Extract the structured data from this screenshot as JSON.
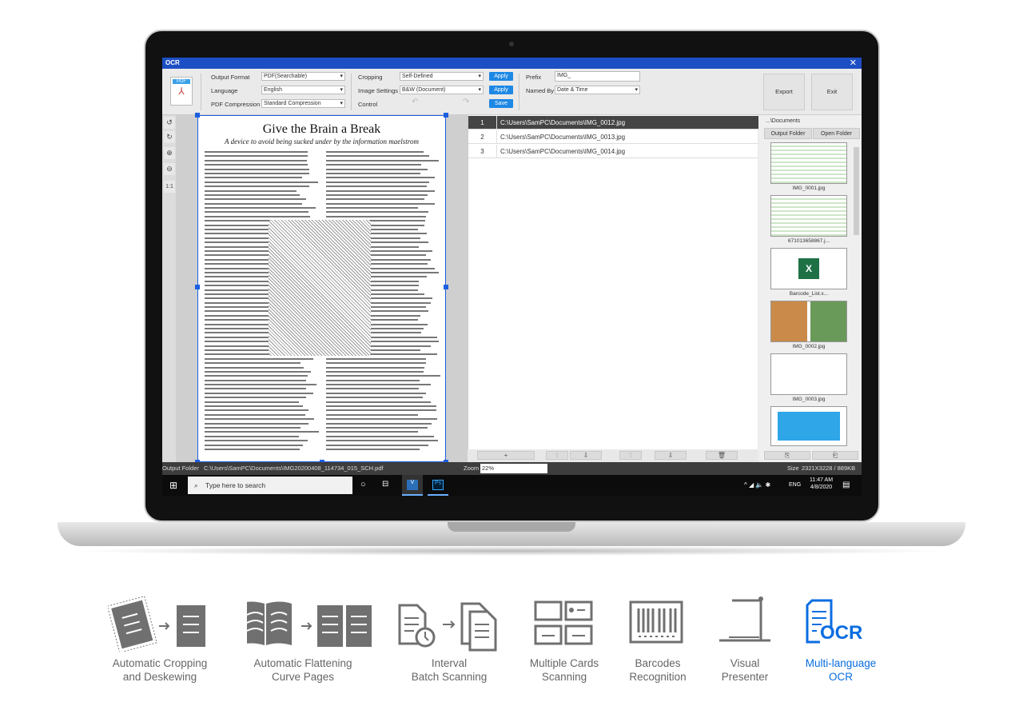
{
  "app": {
    "title": "OCR",
    "close": "✕"
  },
  "toolbar": {
    "output_format_label": "Output Format",
    "output_format": "PDF(Searchable)",
    "language_label": "Language",
    "language": "English",
    "pdf_compression_label": "PDF Compression",
    "pdf_compression": "Standard Compression",
    "cropping_label": "Cropping",
    "cropping": "Self-Defined",
    "image_settings_label": "Image Settings",
    "image_settings": "B&W (Document)",
    "control_label": "Control",
    "apply1": "Apply",
    "apply2": "Apply",
    "save": "Save",
    "prefix_label": "Prefix",
    "prefix": "IMG_",
    "named_by_label": "Named By",
    "named_by": "Date & Time",
    "export": "Export",
    "exit": "Exit",
    "pdf_badge": "PDF"
  },
  "side_tools": [
    "↺",
    "↻",
    "⊕",
    "⊖",
    "1:1"
  ],
  "document": {
    "title": "Give the Brain a Break",
    "subtitle": "A device to avoid being sucked under by the information maelstrom"
  },
  "files": [
    {
      "n": "1",
      "path": "C:\\Users\\SamPC\\Documents\\IMG_0012.jpg"
    },
    {
      "n": "2",
      "path": "C:\\Users\\SamPC\\Documents\\IMG_0013.jpg"
    },
    {
      "n": "3",
      "path": "C:\\Users\\SamPC\\Documents\\IMG_0014.jpg"
    }
  ],
  "right_panel": {
    "path": "...\\Documents",
    "output_folder": "Output Folder",
    "open_folder": "Open Folder",
    "thumbs": [
      "IMG_0001.jpg",
      "671013658867.j...",
      "Barcode_List.x...",
      "IMG_0002.jpg",
      "IMG_0003.jpg"
    ]
  },
  "status": {
    "output_folder_label": "Output Folder",
    "output_folder": "C:\\Users\\SamPC\\Documents\\IMG20200408_114734_015_SCH.pdf",
    "zoom_label": "Zoom",
    "zoom": "22%",
    "size_label": "Size",
    "size": "2321X3228 / 889KB"
  },
  "taskbar": {
    "search_placeholder": "Type here to search",
    "lang": "ENG",
    "time": "11:47 AM",
    "date": "4/8/2020"
  },
  "features": [
    {
      "line1": "Automatic Cropping",
      "line2": "and Deskewing"
    },
    {
      "line1": "Automatic Flattening",
      "line2": "Curve Pages"
    },
    {
      "line1": "Interval",
      "line2": "Batch Scanning"
    },
    {
      "line1": "Multiple Cards",
      "line2": "Scanning"
    },
    {
      "line1": "Barcodes",
      "line2": "Recognition"
    },
    {
      "line1": "Visual",
      "line2": "Presenter"
    },
    {
      "line1": "Multi-language",
      "line2": "OCR",
      "highlight": true
    }
  ],
  "colors": {
    "accent": "#1d4fc4",
    "button": "#1e88e5",
    "feature_gray": "#707070",
    "feature_highlight": "#0a6de0"
  }
}
